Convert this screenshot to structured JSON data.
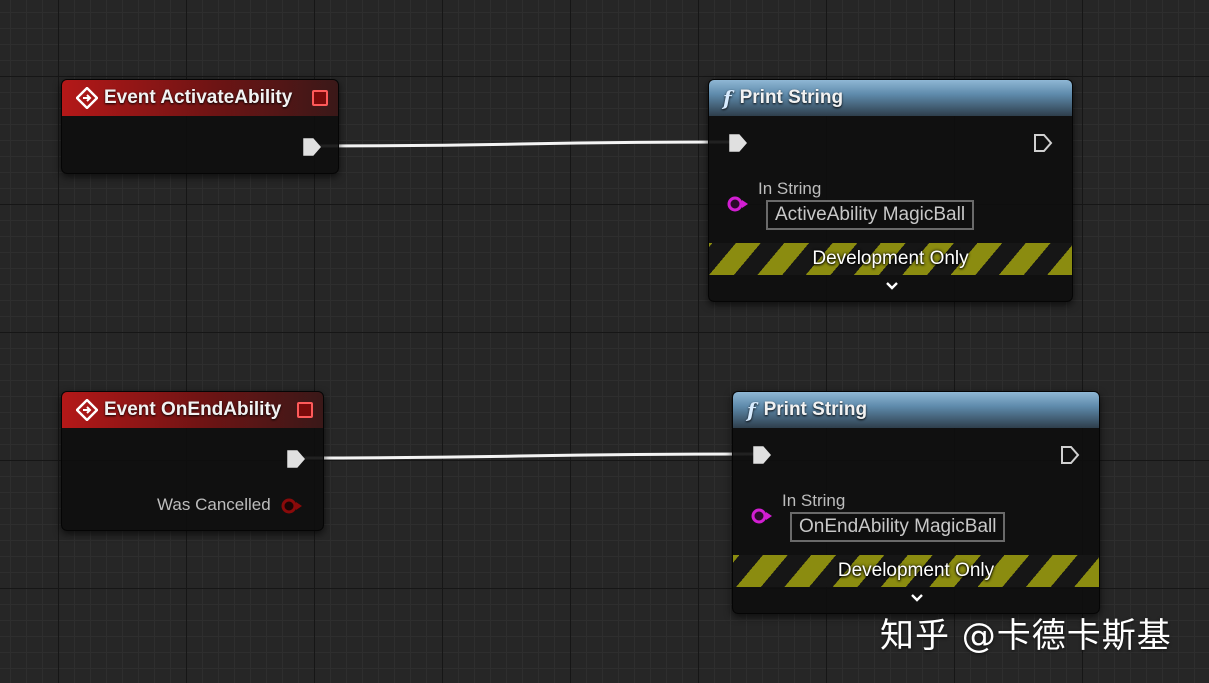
{
  "nodes": {
    "event_activate": {
      "title": "Event ActivateAbility"
    },
    "print_activate": {
      "title": "Print String",
      "in_string_label": "In String",
      "in_string_value": "ActiveAbility MagicBall",
      "dev_label": "Development Only"
    },
    "event_end": {
      "title": "Event OnEndAbility",
      "was_cancelled_label": "Was Cancelled"
    },
    "print_end": {
      "title": "Print String",
      "in_string_label": "In String",
      "in_string_value": "OnEndAbility MagicBall",
      "dev_label": "Development Only"
    }
  },
  "watermark": "知乎 @卡德卡斯基",
  "colors": {
    "event_header": "#b41818",
    "function_header": "#5e8aab",
    "string_pin": "#d21ed2",
    "bool_pin": "#8a0a0a",
    "exec_wire": "#ffffff",
    "dev_stripe": "#8b8c10"
  },
  "icons": {
    "event": "event-diamond-icon",
    "function": "function-f-icon",
    "delegate": "delegate-square-icon",
    "exec": "exec-pin-icon",
    "expand": "chevron-down-icon"
  }
}
